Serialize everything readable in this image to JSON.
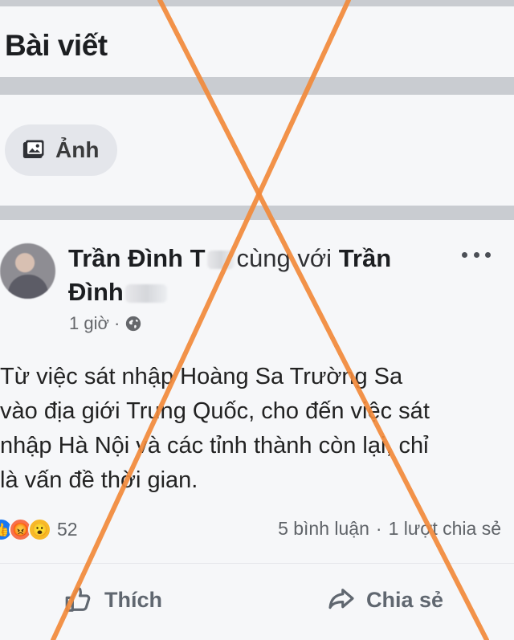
{
  "header": {
    "title": "Bài viết"
  },
  "tools": {
    "photo_label": "Ảnh",
    "photo_icon": "photo-icon"
  },
  "post": {
    "author_line_1_part_1": "Trần Đình T",
    "author_line_1_part_2": "cùng với",
    "author_line_1_part_3": "Trần",
    "author_line_2": "Đình",
    "time_text": "1 giờ ·",
    "privacy_icon": "globe-icon",
    "text": "Từ việc sát nhập Hoàng Sa Trường Sa\nvào địa giới Trung Quốc, cho đến việc sát\nnhập Hà Nội và các tỉnh thành còn lại, chỉ\nlà vấn đề thời gian.",
    "reactions": {
      "count": "52",
      "icons": [
        "like-reaction",
        "angry-reaction",
        "wow-reaction"
      ]
    },
    "comments": "5 bình luận",
    "separator": "·",
    "shares": "1 lượt chia sẻ",
    "actions": {
      "like_label": "Thích",
      "share_label": "Chia sẻ"
    }
  },
  "overlay": {
    "marker": "x-mark",
    "color": "#f28a3b"
  },
  "colors": {
    "background": "#f6f7f9",
    "divider": "#c9ccd1",
    "accent": "#1877f2",
    "secondary_text": "#65676b"
  }
}
